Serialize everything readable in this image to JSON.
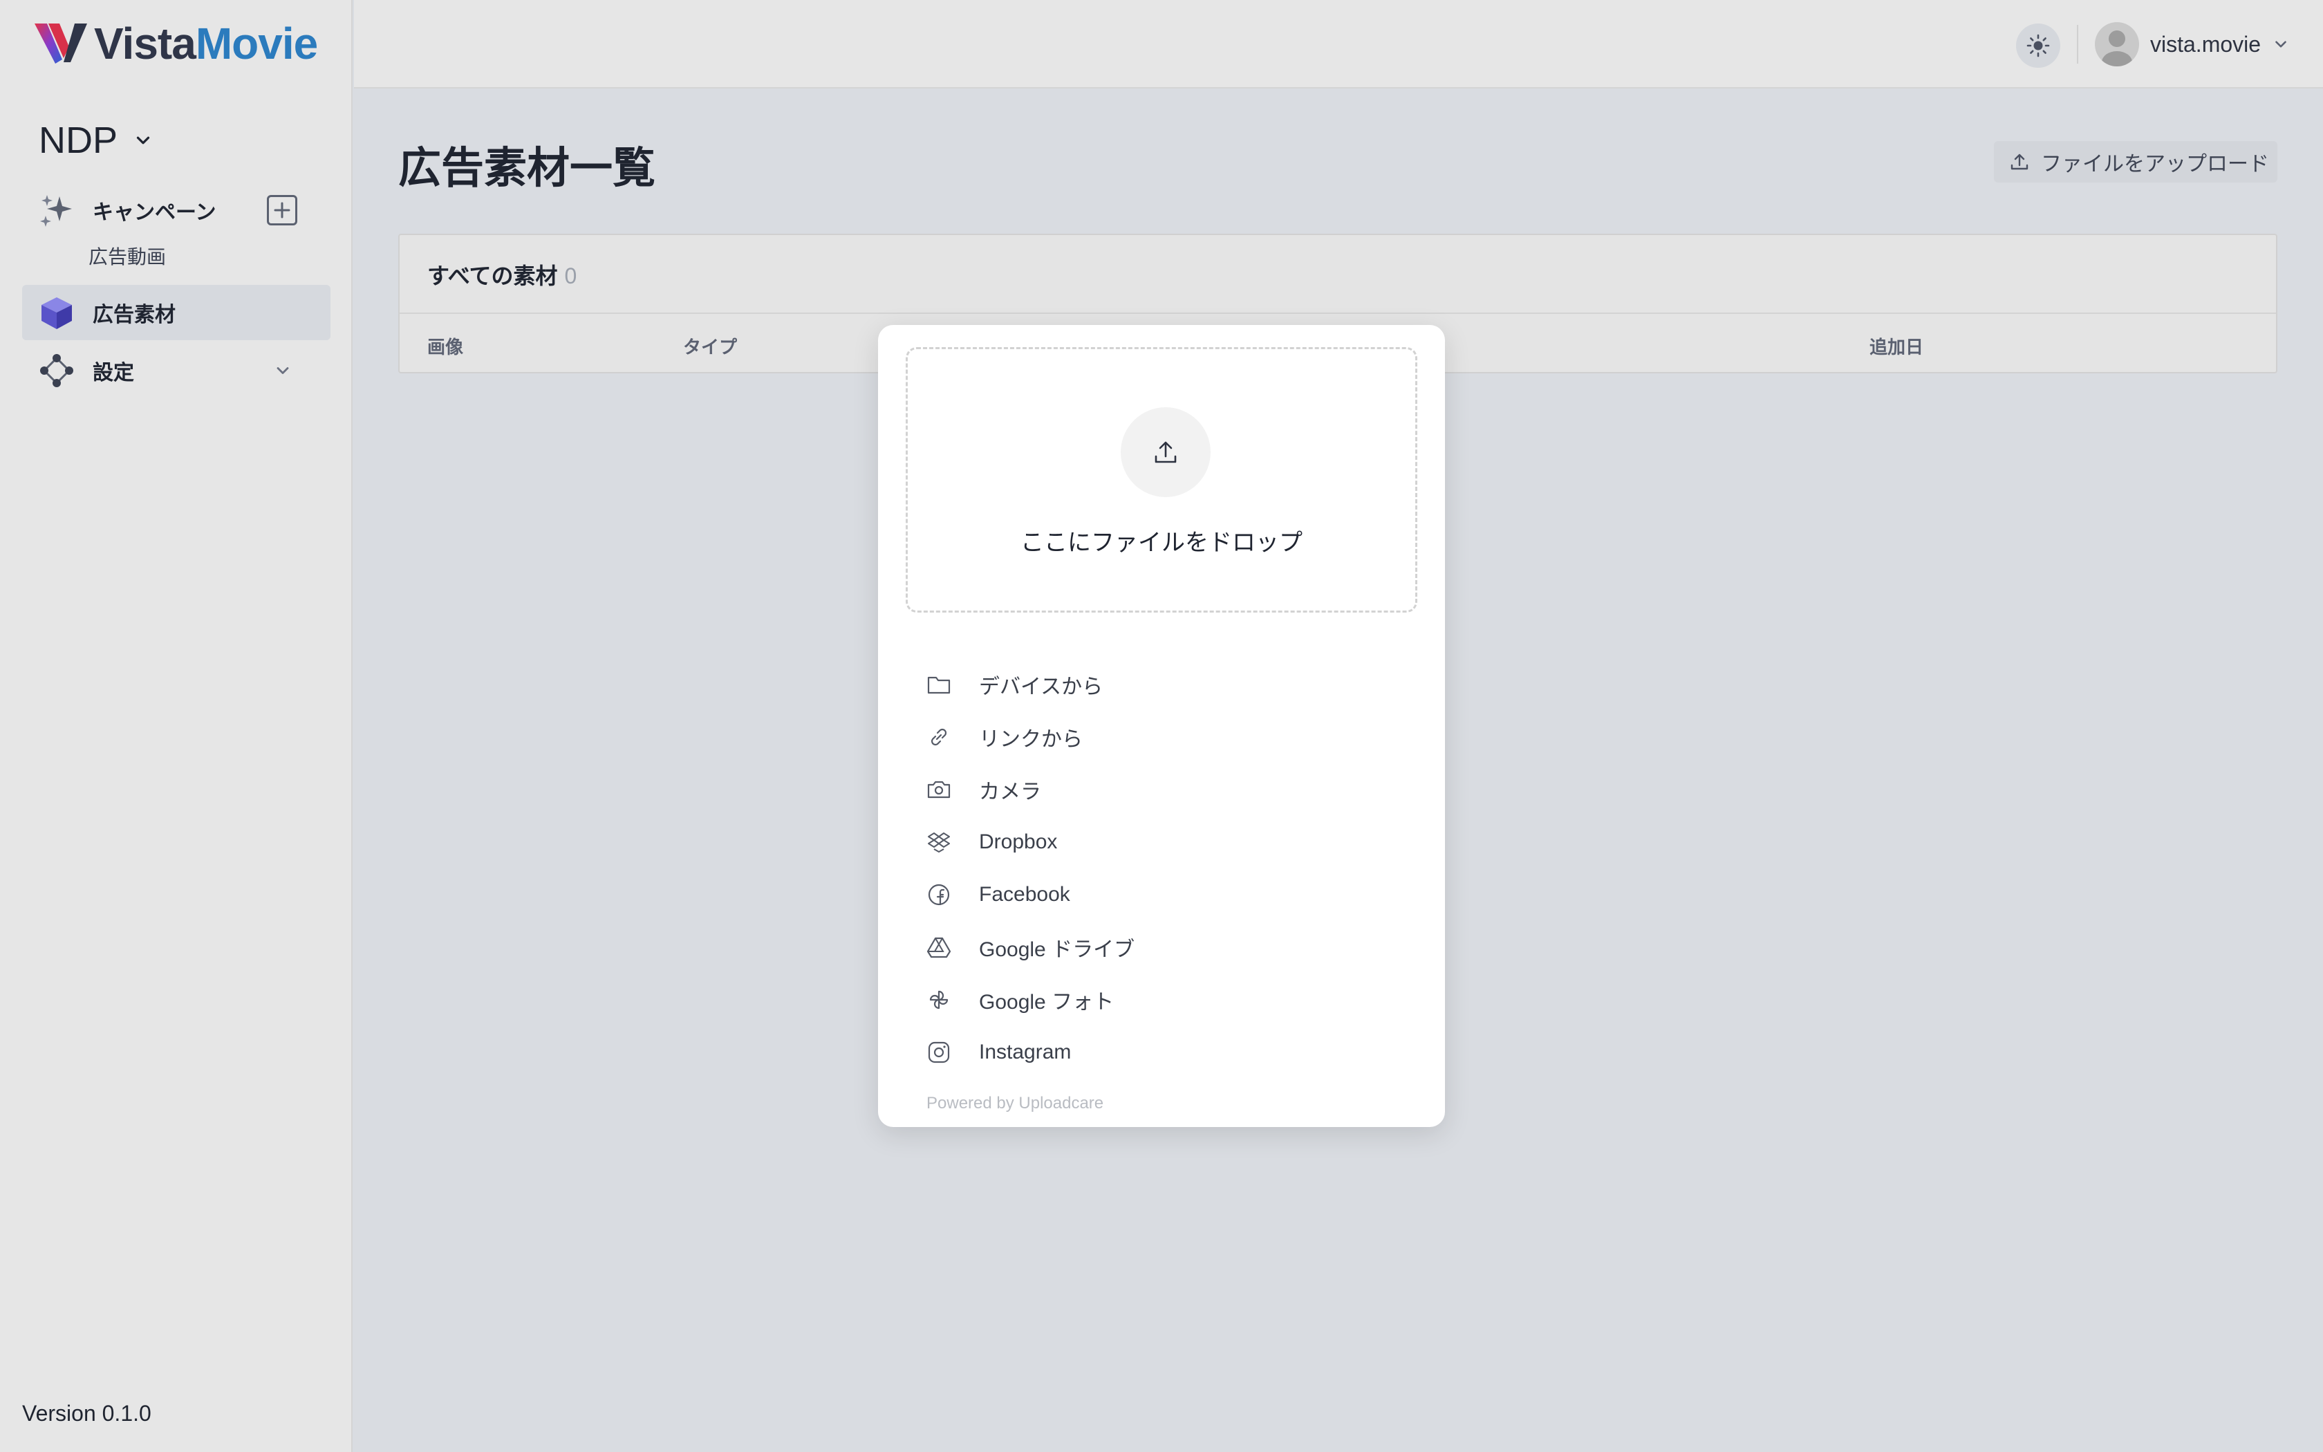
{
  "brand": {
    "name_part1": "Vista",
    "name_part2": "Movie"
  },
  "sidebar": {
    "workspace": "NDP",
    "items": [
      {
        "label": "キャンペーン"
      },
      {
        "label": "広告動画"
      },
      {
        "label": "広告素材"
      },
      {
        "label": "設定"
      }
    ],
    "version": "Version 0.1.0"
  },
  "header": {
    "username": "vista.movie"
  },
  "main": {
    "title": "広告素材一覧",
    "upload_label": "ファイルをアップロード",
    "table": {
      "title": "すべての素材",
      "count": "0",
      "columns": [
        "画像",
        "タイプ",
        "追加日"
      ]
    }
  },
  "dialog": {
    "drop_text": "ここにファイルをドロップ",
    "sources": [
      {
        "label": "デバイスから",
        "icon": "folder-icon"
      },
      {
        "label": "リンクから",
        "icon": "link-icon"
      },
      {
        "label": "カメラ",
        "icon": "camera-icon"
      },
      {
        "label": "Dropbox",
        "icon": "dropbox-icon"
      },
      {
        "label": "Facebook",
        "icon": "facebook-icon"
      },
      {
        "label": "Google ドライブ",
        "icon": "google-drive-icon"
      },
      {
        "label": "Google フォト",
        "icon": "google-photos-icon"
      },
      {
        "label": "Instagram",
        "icon": "instagram-icon"
      }
    ],
    "powered_by": "Powered by Uploadcare"
  },
  "colors": {
    "brand_dark": "#2f3548",
    "brand_blue": "#2b7bbd",
    "sidebar_bg": "#e6e6e6",
    "main_bg": "#d9dce1",
    "active_bg": "#d6d9de"
  }
}
